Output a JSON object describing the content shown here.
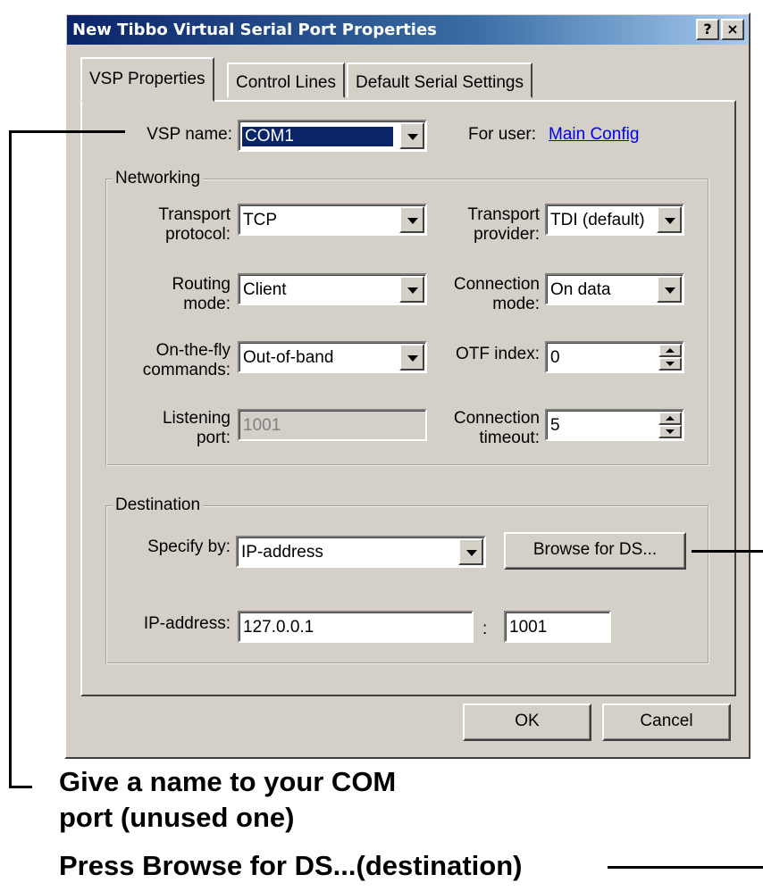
{
  "window": {
    "title": "New Tibbo Virtual Serial Port Properties",
    "help_glyph": "?",
    "close_glyph": "×"
  },
  "tabs": [
    {
      "label": "VSP Properties",
      "active": true
    },
    {
      "label": "Control Lines",
      "active": false
    },
    {
      "label": "Default Serial Settings",
      "active": false
    }
  ],
  "vsp": {
    "name_label": "VSP name:",
    "name_value": "COM1",
    "for_user_label": "For user:",
    "for_user_link": "Main Config"
  },
  "networking": {
    "title": "Networking",
    "transport_protocol": {
      "label_1": "Transport",
      "label_2": "protocol:",
      "value": "TCP"
    },
    "transport_provider": {
      "label_1": "Transport",
      "label_2": "provider:",
      "value": "TDI (default)"
    },
    "routing_mode": {
      "label_1": "Routing",
      "label_2": "mode:",
      "value": "Client"
    },
    "connection_mode": {
      "label_1": "Connection",
      "label_2": "mode:",
      "value": "On data"
    },
    "otf_commands": {
      "label_1": "On-the-fly",
      "label_2": "commands:",
      "value": "Out-of-band"
    },
    "otf_index": {
      "label": "OTF index:",
      "value": "0"
    },
    "listening_port": {
      "label_1": "Listening",
      "label_2": "port:",
      "value": "1001"
    },
    "connection_timeout": {
      "label_1": "Connection",
      "label_2": "timeout:",
      "value": "5"
    }
  },
  "destination": {
    "title": "Destination",
    "specify_label": "Specify by:",
    "specify_value": "IP-address",
    "browse_label": "Browse for DS...",
    "ip_label": "IP-address:",
    "ip_value": "127.0.0.1",
    "colon": ":",
    "port_value": "1001"
  },
  "buttons": {
    "ok": "OK",
    "cancel": "Cancel"
  },
  "callouts": {
    "name_line1": "Give a name to your COM",
    "name_line2": "port (unused one)",
    "browse": "Press Browse for DS...(destination)"
  }
}
